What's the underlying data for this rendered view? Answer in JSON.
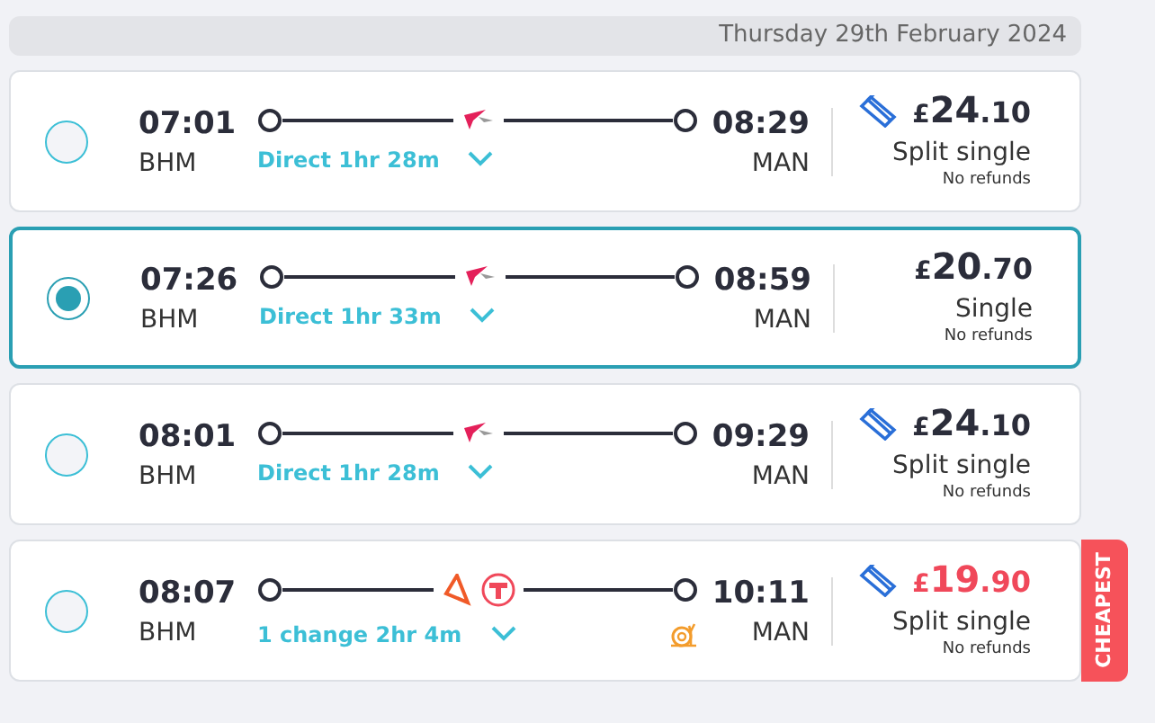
{
  "date_header": "Thursday 29th February 2024",
  "journeys": [
    {
      "selected": false,
      "depart": "07:01",
      "origin": "BHM",
      "arrive": "08:29",
      "destination": "MAN",
      "summary": "Direct 1hr 28m",
      "operators": [
        {
          "kind": "cross"
        }
      ],
      "slow": false,
      "split": true,
      "currency": "£",
      "pounds": "24",
      "pence": ".10",
      "ticket": "Split single",
      "refund": "No refunds"
    },
    {
      "selected": true,
      "depart": "07:26",
      "origin": "BHM",
      "arrive": "08:59",
      "destination": "MAN",
      "summary": "Direct 1hr 33m",
      "operators": [
        {
          "kind": "cross"
        }
      ],
      "slow": false,
      "split": false,
      "currency": "£",
      "pounds": "20",
      "pence": ".70",
      "ticket": "Single",
      "refund": "No refunds"
    },
    {
      "selected": false,
      "depart": "08:01",
      "origin": "BHM",
      "arrive": "09:29",
      "destination": "MAN",
      "summary": "Direct 1hr 28m",
      "operators": [
        {
          "kind": "cross"
        }
      ],
      "slow": false,
      "split": true,
      "currency": "£",
      "pounds": "24",
      "pence": ".10",
      "ticket": "Split single",
      "refund": "No refunds"
    },
    {
      "selected": false,
      "depart": "08:07",
      "origin": "BHM",
      "arrive": "10:11",
      "destination": "MAN",
      "summary": "1 change 2hr 4m",
      "operators": [
        {
          "kind": "triangle"
        },
        {
          "kind": "tram"
        }
      ],
      "slow": true,
      "split": true,
      "currency": "£",
      "pounds": "19",
      "pence": ".90",
      "ticket": "Split single",
      "refund": "No refunds",
      "badge": "CHEAPEST"
    }
  ]
}
